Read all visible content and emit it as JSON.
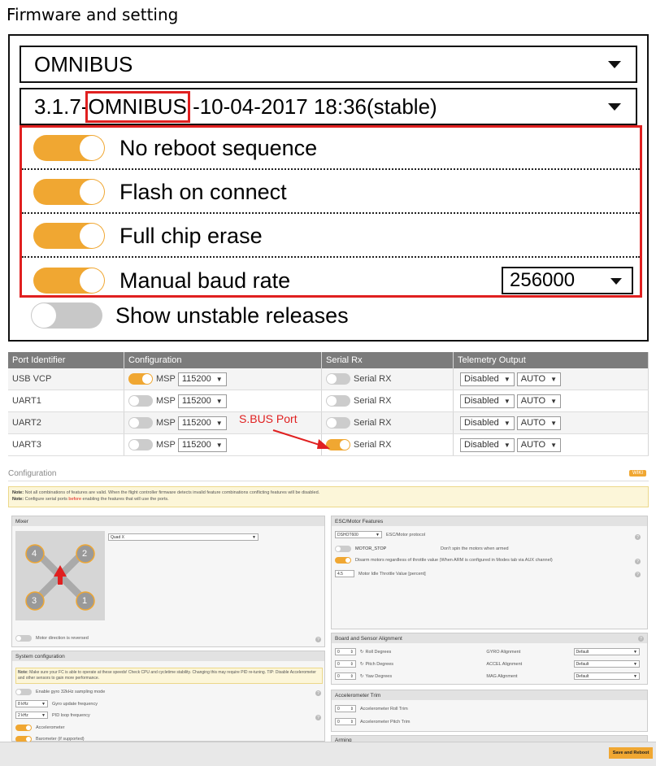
{
  "firmware": {
    "heading": "Firmware and setting",
    "board": "OMNIBUS",
    "version_prefix": "3.1.7-",
    "version_target": "OMNIBUS",
    "version_suffix": " -10-04-2017 18:36(stable)",
    "options": [
      {
        "label": "No reboot sequence",
        "enabled": true
      },
      {
        "label": "Flash on connect",
        "enabled": true
      },
      {
        "label": "Full chip erase",
        "enabled": true
      },
      {
        "label": "Manual baud rate",
        "enabled": true
      }
    ],
    "baud_rate": "256000",
    "unstable": {
      "label": "Show unstable releases",
      "enabled": false
    }
  },
  "ports": {
    "headers": [
      "Port Identifier",
      "Configuration",
      "Serial Rx",
      "Telemetry Output"
    ],
    "rows": [
      {
        "id": "USB VCP",
        "msp_on": true,
        "msp": "MSP",
        "baud": "115200",
        "rx_on": false,
        "rx": "Serial RX",
        "telemetry": "Disabled",
        "auto": "AUTO"
      },
      {
        "id": "UART1",
        "msp_on": false,
        "msp": "MSP",
        "baud": "115200",
        "rx_on": false,
        "rx": "Serial RX",
        "telemetry": "Disabled",
        "auto": "AUTO"
      },
      {
        "id": "UART2",
        "msp_on": false,
        "msp": "MSP",
        "baud": "115200",
        "rx_on": false,
        "rx": "Serial RX",
        "telemetry": "Disabled",
        "auto": "AUTO"
      },
      {
        "id": "UART3",
        "msp_on": false,
        "msp": "MSP",
        "baud": "115200",
        "rx_on": true,
        "rx": "Serial RX",
        "telemetry": "Disabled",
        "auto": "AUTO"
      }
    ],
    "annotation": "S.BUS Port"
  },
  "config": {
    "title": "Configuration",
    "wiki": "WIKI",
    "note_prefix": "Note:",
    "note_line1": " Not all combinations of features are valid. When the flight controller firmware detects invalid feature combinations conflicting features will be disabled.",
    "note_line2a": " Configure serial ports ",
    "note_before": "before",
    "note_line2b": " enabling the features that will use the ports.",
    "mixer": {
      "title": "Mixer",
      "type": "Quad X",
      "motors": [
        "4",
        "2",
        "3",
        "1"
      ],
      "reversed_label": "Motor direction is reversed"
    },
    "system": {
      "title": "System configuration",
      "note": "Make sure your FC is able to operate at these speeds! Check CPU and cycletime stability. Changing this may require PID re-tuning. TIP: Disable Accelerometer and other sensors to gain more performance.",
      "gyro32_label": "Enable gyro 32kHz sampling mode",
      "gyro_freq": "8 kHz",
      "gyro_freq_label": "Gyro update frequency",
      "pid_freq": "2 kHz",
      "pid_freq_label": "PID loop frequency",
      "accel_label": "Accelerometer",
      "baro_label": "Barometer (if supported)"
    },
    "esc": {
      "title": "ESC/Motor Features",
      "protocol": "DSHOT600",
      "protocol_label": "ESC/Motor protocol",
      "motor_stop": "MOTOR_STOP",
      "motor_stop_desc": "Don't spin the motors when armed",
      "disarm_label": "Disarm motors regardless of throttle value (When ARM is configured in Modes tab via AUX channel)",
      "idle_value": "4.5",
      "idle_label": "Motor Idle Throttle Value [percent]"
    },
    "alignment": {
      "title": "Board and Sensor Alignment",
      "rows": [
        {
          "value": "0",
          "label": "Roll Degrees",
          "sensor": "GYRO Alignment",
          "option": "Default"
        },
        {
          "value": "0",
          "label": "Pitch Degrees",
          "sensor": "ACCEL Alignment",
          "option": "Default"
        },
        {
          "value": "0",
          "label": "Yaw Degrees",
          "sensor": "MAG Alignment",
          "option": "Default"
        }
      ]
    },
    "accel_trim": {
      "title": "Accelerometer Trim",
      "roll_value": "0",
      "roll_label": "Accelerometer Roll Trim",
      "pitch_value": "0",
      "pitch_label": "Accelerometer Pitch Trim"
    },
    "arming_title": "Arming",
    "save_label": "Save and Reboot"
  },
  "colors": {
    "accent": "#f0a732",
    "highlight": "#e02020",
    "header": "#7c7c7c"
  }
}
